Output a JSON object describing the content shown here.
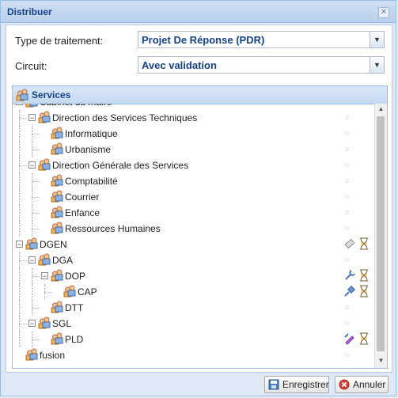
{
  "window": {
    "title": "Distribuer"
  },
  "form": {
    "type_label": "Type de traitement:",
    "type_value": "Projet De Réponse (PDR)",
    "circuit_label": "Circuit:",
    "circuit_value": "Avec validation"
  },
  "panel": {
    "title": "Services"
  },
  "tree": {
    "nodes": [
      {
        "label": "Cabinet du maire",
        "level": 0
      },
      {
        "label": "Direction des Services Techniques",
        "level": 1
      },
      {
        "label": "Informatique",
        "level": 2
      },
      {
        "label": "Urbanisme",
        "level": 2
      },
      {
        "label": "Direction Générale des Services",
        "level": 1
      },
      {
        "label": "Comptabilité",
        "level": 2
      },
      {
        "label": "Courrier",
        "level": 2
      },
      {
        "label": "Enfance",
        "level": 2
      },
      {
        "label": "Ressources Humaines",
        "level": 2
      },
      {
        "label": "DGEN",
        "level": 0
      },
      {
        "label": "DGA",
        "level": 1
      },
      {
        "label": "DOP",
        "level": 2
      },
      {
        "label": "CAP",
        "level": 3
      },
      {
        "label": "DTT",
        "level": 2
      },
      {
        "label": "SGL",
        "level": 1
      },
      {
        "label": "PLD",
        "level": 2
      },
      {
        "label": "fusion",
        "level": 0
      }
    ]
  },
  "buttons": {
    "save": "Enregistrer",
    "cancel": "Annuler"
  },
  "colors": {
    "accent": "#15428b",
    "border": "#99bbe8"
  }
}
